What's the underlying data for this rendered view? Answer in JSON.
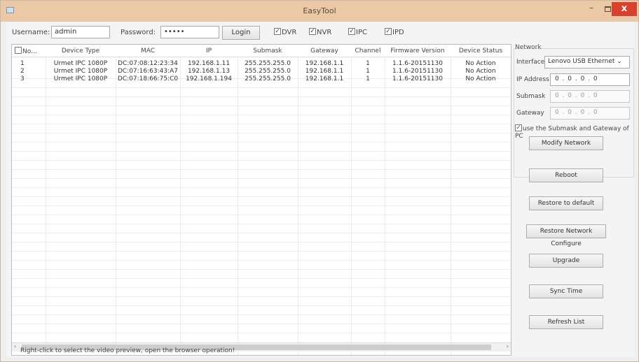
{
  "window": {
    "title": "EasyTool",
    "min_glyph": "–",
    "close_glyph": "x"
  },
  "login": {
    "username_label": "Username:",
    "username_value": "admin",
    "password_label": "Password:",
    "password_value": "•••••",
    "login_button": "Login"
  },
  "filters": [
    {
      "label": "DVR",
      "checked": true
    },
    {
      "label": "NVR",
      "checked": true
    },
    {
      "label": "IPC",
      "checked": true
    },
    {
      "label": "IPD",
      "checked": true
    }
  ],
  "table": {
    "columns": [
      "No...",
      "Device Type",
      "MAC",
      "IP",
      "Submask",
      "Gateway",
      "Channel",
      "Firmware Version",
      "Device Status"
    ],
    "rows": [
      [
        "1",
        "Urmet IPC 1080P",
        "DC:07:08:12:23:34",
        "192.168.1.11",
        "255.255.255.0",
        "192.168.1.1",
        "1",
        "1.1.6-20151130",
        "No Action"
      ],
      [
        "2",
        "Urmet IPC 1080P",
        "DC:07:16:63:43:A7",
        "192.168.1.13",
        "255.255.255.0",
        "192.168.1.1",
        "1",
        "1.1.6-20151130",
        "No Action"
      ],
      [
        "3",
        "Urmet IPC 1080P",
        "DC:07:18:66:75:C0",
        "192.168.1.194",
        "255.255.255.0",
        "192.168.1.1",
        "1",
        "1.1.6-20151130",
        "No Action"
      ]
    ]
  },
  "network": {
    "group_label": "Network",
    "interface_label": "Interface",
    "interface_value": "Lenovo USB Ethernet",
    "ip_label": "IP Address",
    "ip_value": "0 . 0 . 0 . 0",
    "submask_label": "Submask",
    "submask_value": "0 . 0 . 0 . 0",
    "gateway_label": "Gateway",
    "gateway_value": "0 . 0 . 0 . 0",
    "use_pc_label": "use the Submask and Gateway of PC",
    "modify_button": "Modify Network"
  },
  "actions": {
    "reboot": "Reboot",
    "restore_default": "Restore to default",
    "restore_network": "Restore Network Configure",
    "upgrade": "Upgrade",
    "sync_time": "Sync Time",
    "refresh": "Refresh List"
  },
  "status_text": "Right-click to select the video preview, open the browser operation!",
  "icons": {
    "checkmark": "✓",
    "chevron": "⌄",
    "left_arrow": "‹",
    "right_arrow": "›"
  },
  "colors": {
    "titlebar": "#ecc9a6",
    "close": "#d9412f"
  }
}
